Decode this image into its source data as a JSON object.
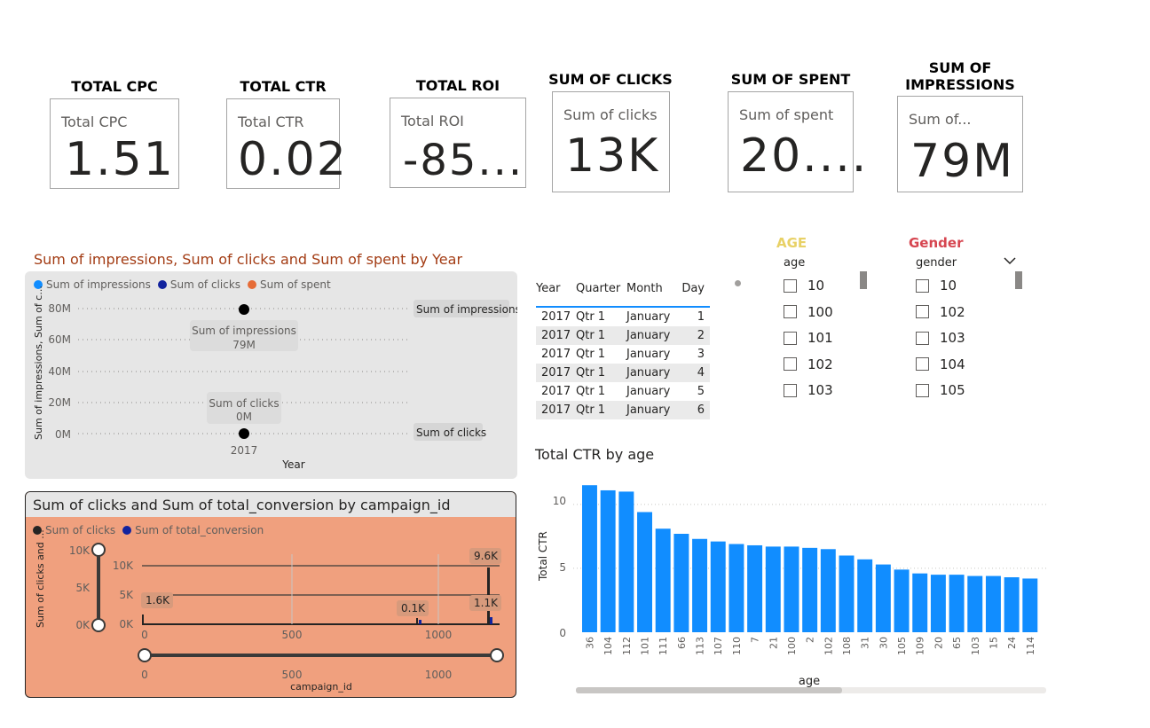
{
  "kpis": [
    {
      "title": "TOTAL CPC",
      "label": "Total CPC",
      "value": "1.51"
    },
    {
      "title": "TOTAL CTR",
      "label": "Total CTR",
      "value": "0.02"
    },
    {
      "title": "TOTAL ROI",
      "label": "Total ROI",
      "value": "-85..."
    },
    {
      "title": "SUM OF CLICKS",
      "label": "Sum of clicks",
      "value": "13K"
    },
    {
      "title": "SUM OF SPENT",
      "label": "Sum of spent",
      "value": "20...."
    },
    {
      "title_line1": "SUM OF",
      "title_line2": "IMPRESSIONS",
      "label": "Sum of...",
      "value": "79M"
    }
  ],
  "year_chart": {
    "title": "Sum of impressions, Sum of clicks and Sum of spent by Year",
    "legend": [
      {
        "name": "Sum of impressions",
        "color": "#118dff"
      },
      {
        "name": "Sum of clicks",
        "color": "#12239e"
      },
      {
        "name": "Sum of spent",
        "color": "#e66c37"
      }
    ],
    "ylabel": "Sum of impressions, Sum of c...",
    "xlabel": "Year",
    "yticks": [
      "80M",
      "60M",
      "40M",
      "20M",
      "0M"
    ],
    "xtick": "2017",
    "tooltip_impressions": {
      "label": "Sum of impressions",
      "value": "79M"
    },
    "tooltip_clicks": {
      "label": "Sum of clicks",
      "value": "0M"
    },
    "callout_impressions": "Sum of impressions",
    "callout_clicks": "Sum of clicks"
  },
  "campaign_chart": {
    "title": "Sum of clicks and Sum of total_conversion by campaign_id",
    "legend": [
      {
        "name": "Sum of clicks",
        "color": "#252423"
      },
      {
        "name": "Sum of total_conversion",
        "color": "#12239e"
      }
    ],
    "ylabel": "Sum of clicks and ...",
    "xlabel": "campaign_id",
    "slider_yticks": [
      "10K",
      "5K",
      "0K"
    ],
    "yticks": [
      "10K",
      "5K",
      "0K"
    ],
    "xticks": [
      "0",
      "500",
      "1000"
    ],
    "slider_xticks": [
      "0",
      "500",
      "1000"
    ],
    "labels": [
      "1.6K",
      "0.1K",
      "9.6K",
      "1.1K"
    ]
  },
  "table": {
    "headers": [
      "Year",
      "Quarter",
      "Month",
      "Day"
    ],
    "rows": [
      [
        "2017",
        "Qtr 1",
        "January",
        "1"
      ],
      [
        "2017",
        "Qtr 1",
        "January",
        "2"
      ],
      [
        "2017",
        "Qtr 1",
        "January",
        "3"
      ],
      [
        "2017",
        "Qtr 1",
        "January",
        "4"
      ],
      [
        "2017",
        "Qtr 1",
        "January",
        "5"
      ],
      [
        "2017",
        "Qtr 1",
        "January",
        "6"
      ]
    ]
  },
  "age_slicer": {
    "title": "AGE",
    "title_color": "#e8d166",
    "field": "age",
    "items": [
      "10",
      "100",
      "101",
      "102",
      "103"
    ]
  },
  "gender_slicer": {
    "title": "Gender",
    "title_color": "#d64550",
    "field": "gender",
    "items": [
      "10",
      "102",
      "103",
      "104",
      "105"
    ]
  },
  "chart_data": {
    "type": "bar",
    "title": "Total CTR by age",
    "xlabel": "age",
    "ylabel": "Total CTR",
    "ylim": [
      0,
      12
    ],
    "yticks": [
      "10",
      "5",
      "0"
    ],
    "color": "#118dff",
    "categories": [
      "36",
      "104",
      "112",
      "101",
      "111",
      "66",
      "113",
      "107",
      "110",
      "7",
      "21",
      "100",
      "2",
      "102",
      "108",
      "31",
      "30",
      "105",
      "109",
      "20",
      "65",
      "103",
      "15",
      "24",
      "114"
    ],
    "values": [
      11.5,
      11.1,
      11.0,
      9.4,
      8.1,
      7.7,
      7.3,
      7.1,
      6.9,
      6.8,
      6.7,
      6.7,
      6.6,
      6.5,
      6.0,
      5.7,
      5.3,
      4.9,
      4.6,
      4.5,
      4.5,
      4.4,
      4.4,
      4.3,
      4.2
    ]
  }
}
